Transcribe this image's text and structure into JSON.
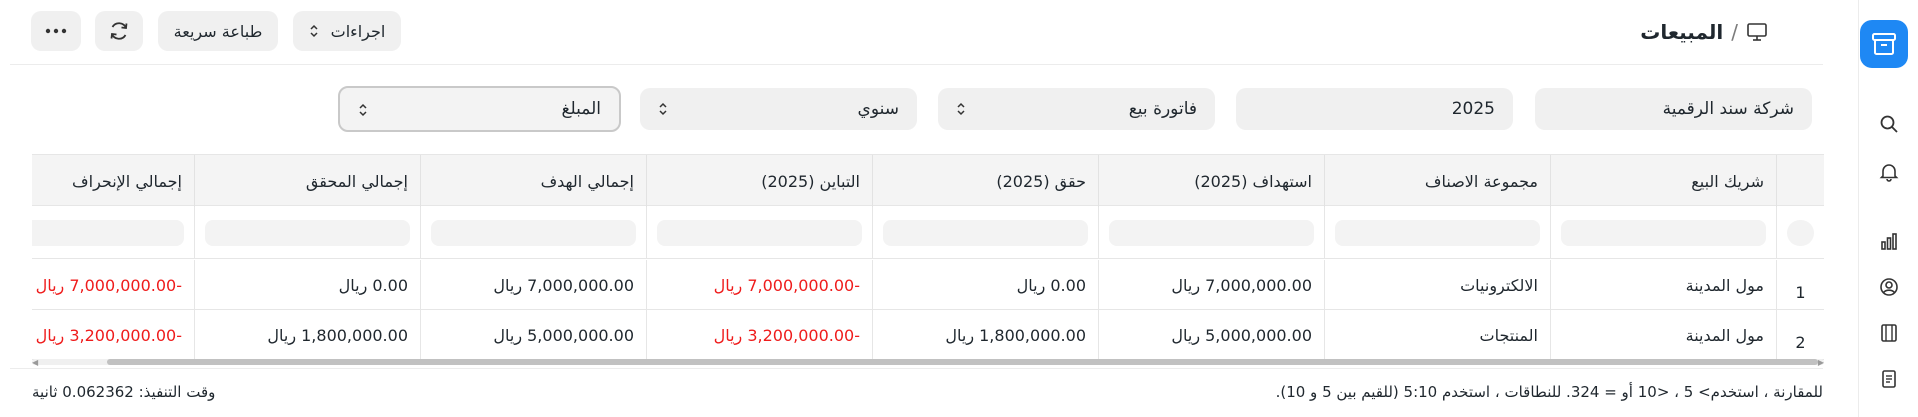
{
  "breadcrumb": {
    "separator": "/",
    "title": "المبيعات",
    "icon": "desktop-icon"
  },
  "toolbar": {
    "actions_label": "اجراءات",
    "quick_print_label": "طباعة سريعة",
    "refresh_icon": "refresh-icon",
    "more_icon": "more-icon"
  },
  "filters": {
    "company": "شركة سند الرقمية",
    "year": "2025",
    "doctype": "فاتورة بيع",
    "period": "سنوي",
    "value_type": "المبلغ"
  },
  "table": {
    "columns": [
      "شريك البيع",
      "مجموعة الاصناف",
      "استهداف (2025)",
      "حقق (2025)",
      "التباين (2025)",
      "إجمالي الهدف",
      "إجمالي المحقق",
      "إجمالي الإنحراف"
    ],
    "rows": [
      {
        "idx": "1",
        "partner": "مول المدينة",
        "group": "الالكترونيات",
        "target": "7,000,000.00 ريال",
        "achieved": "0.00 ريال",
        "variance": "-7,000,000.00 ريال",
        "total_target": "7,000,000.00 ريال",
        "total_achieved": "0.00 ريال",
        "total_deviation": "-7,000,000.00 ريال"
      },
      {
        "idx": "2",
        "partner": "مول المدينة",
        "group": "المنتجات",
        "target": "5,000,000.00 ريال",
        "achieved": "1,800,000.00 ريال",
        "variance": "-3,200,000.00 ريال",
        "total_target": "5,000,000.00 ريال",
        "total_achieved": "1,800,000.00 ريال",
        "total_deviation": "-3,200,000.00 ريال"
      }
    ]
  },
  "footer": {
    "hint": "للمقارنة ، استخدم> 5 ، <10 أو = 324. للنطاقات ، استخدم 5:10 (للقيم بين 5 و 10).",
    "exec_time": "وقت التنفيذ: 0.062362 ثانية"
  },
  "colors": {
    "accent": "#1e88f4",
    "negative": "#ef1c1c"
  }
}
